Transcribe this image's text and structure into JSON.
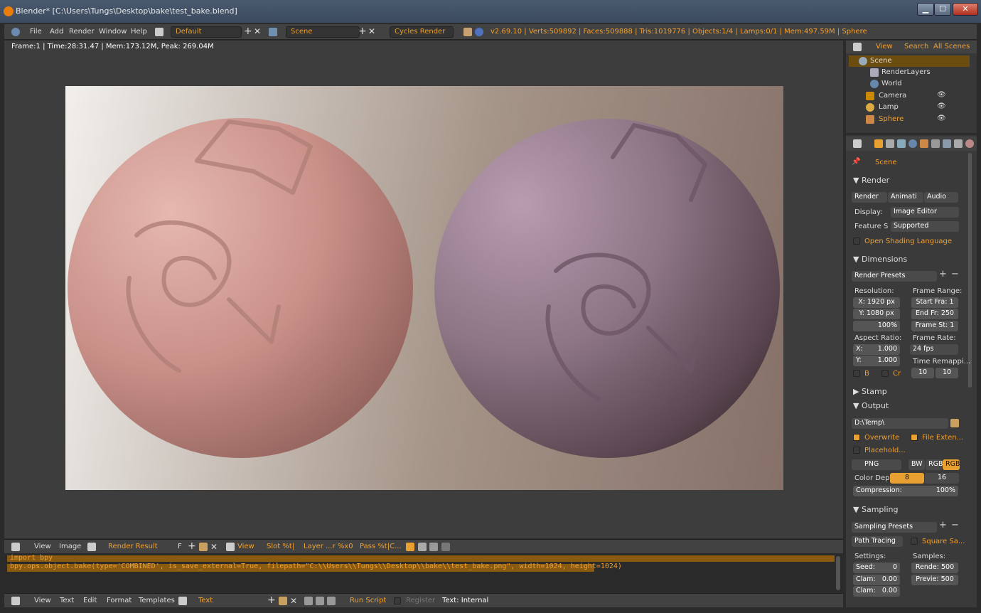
{
  "window": {
    "title": "Blender* [C:\\Users\\Tungs\\Desktop\\bake\\test_bake.blend]",
    "min": "▁",
    "max": "☐",
    "close": "✕"
  },
  "menu": {
    "file": "File",
    "add": "Add",
    "render": "Render",
    "window": "Window",
    "help": "Help",
    "layout": "Default",
    "scene": "Scene",
    "engine": "Cycles Render",
    "stats": "v2.69.10 | Verts:509892 | Faces:509888 | Tris:1019776 | Objects:1/4 | Lamps:0/1 | Mem:497.59M | Sphere"
  },
  "render_info": "Frame:1 | Time:28:31.47 | Mem:173.12M, Peak: 269.04M",
  "image_header": {
    "view": "View",
    "image": "Image",
    "result": "Render Result",
    "f": "F",
    "view2": "View",
    "slot": "Slot %t|",
    "layer": "Layer ...r %x0",
    "pass": "Pass %t|C..."
  },
  "code": {
    "line1": "import bpy",
    "line2": "bpy.ops.object.bake(type='COMBINED', is_save_external=True, filepath=\"C:\\\\Users\\\\Tungs\\\\Desktop\\\\bake\\\\test_bake.png\", width=1024, height=1024)"
  },
  "text_header": {
    "view": "View",
    "text": "Text",
    "edit": "Edit",
    "format": "Format",
    "templates": "Templates",
    "name": "Text",
    "run": "Run Script",
    "register": "Register",
    "internal": "Text: Internal"
  },
  "outliner": {
    "view": "View",
    "search": "Search",
    "all": "All Scenes",
    "items": [
      "Scene",
      "RenderLayers",
      "World",
      "Camera",
      "Lamp",
      "Sphere"
    ]
  },
  "props": {
    "scene": "Scene",
    "render_sect": "Render",
    "render_btn": "Render",
    "anim_btn": "Animati",
    "audio_btn": "Audio",
    "display_lbl": "Display:",
    "display_val": "Image Editor",
    "feature_lbl": "Feature S",
    "feature_val": "Supported",
    "osl": "Open Shading Language",
    "dims": "Dimensions",
    "presets": "Render Presets",
    "res_lbl": "Resolution:",
    "res_x": "X: 1920 px",
    "res_y": "Y: 1080 px",
    "res_pct": "100%",
    "frange_lbl": "Frame Range:",
    "start": "Start Fra: 1",
    "end": "End Fr: 250",
    "step": "Frame St: 1",
    "aspect_lbl": "Aspect Ratio:",
    "asp_x": "X:",
    "asp_x_val": "1.000",
    "asp_y": "Y:",
    "asp_y_val": "1.000",
    "fps_lbl": "Frame Rate:",
    "fps": "24 fps",
    "remap": "Time Remappi...",
    "remap_old": "10",
    "remap_new": "10",
    "b": "B",
    "cr": "Cr",
    "stamp": "Stamp",
    "output": "Output",
    "path": "D:\\Temp\\",
    "overwrite": "Overwrite",
    "file_ext": "File Exten...",
    "placeholders": "Placehold...",
    "format": "PNG",
    "bw": "BW",
    "rgb": "RGB",
    "rgba": "RGB",
    "color_dep": "Color Dep",
    "dep8": "8",
    "dep16": "16",
    "compression": "Compression:",
    "comp_val": "100%",
    "sampling": "Sampling",
    "samp_presets": "Sampling Presets",
    "path_tracing": "Path Tracing",
    "square": "Square Sa...",
    "settings": "Settings:",
    "samples": "Samples:",
    "seed": "Seed:",
    "seed_val": "0",
    "clam1": "Clam:",
    "clam1_val": "0.00",
    "clam2": "Clam:",
    "clam2_val": "0.00",
    "render_s": "Rende: 500",
    "preview_s": "Previe: 500"
  },
  "colors": {
    "accent": "#e8a030",
    "bg": "#2b2b2b"
  }
}
